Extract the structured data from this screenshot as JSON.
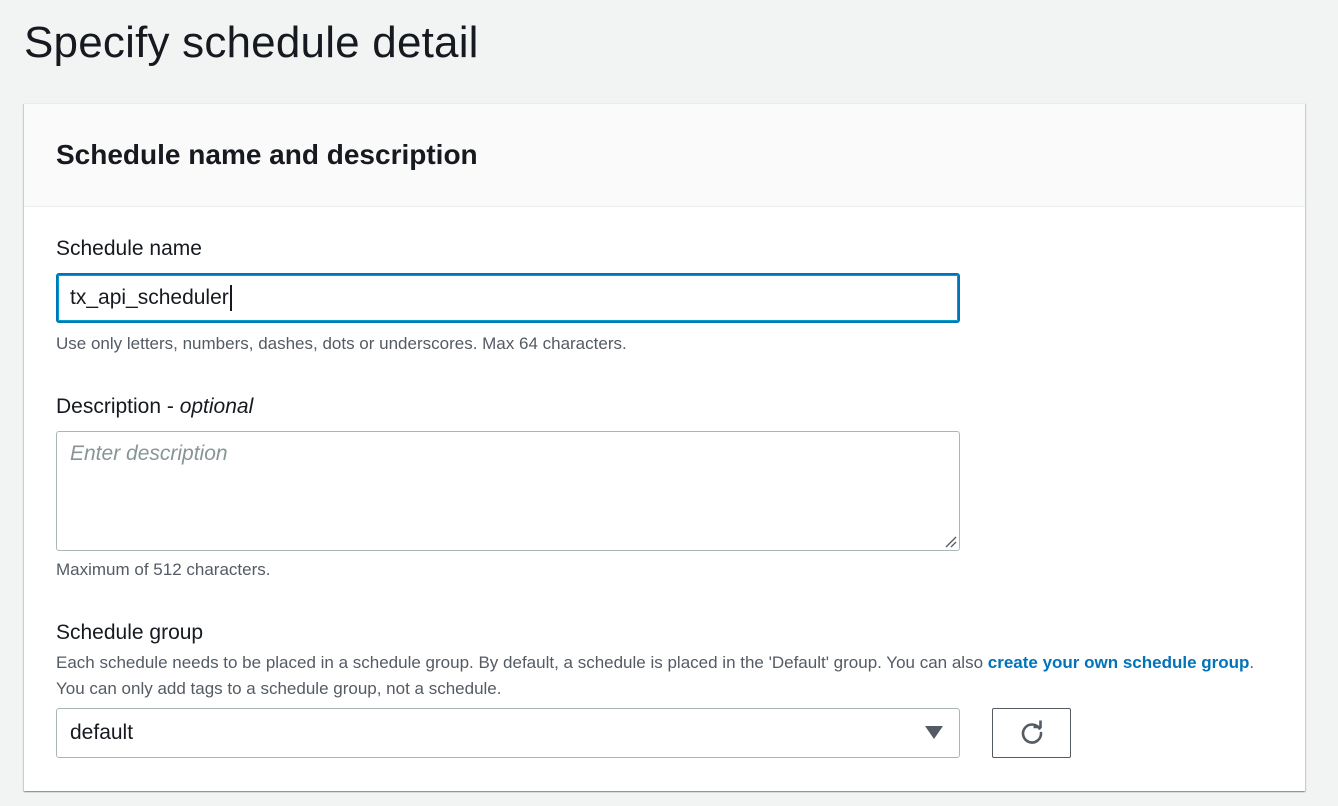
{
  "page": {
    "title": "Specify schedule detail"
  },
  "section": {
    "title": "Schedule name and description"
  },
  "schedule_name": {
    "label": "Schedule name",
    "value": "tx_api_scheduler",
    "hint": "Use only letters, numbers, dashes, dots or underscores. Max 64 characters."
  },
  "description": {
    "label": "Description - ",
    "label_optional": "optional",
    "placeholder": "Enter description",
    "hint": "Maximum of 512 characters."
  },
  "schedule_group": {
    "label": "Schedule group",
    "desc_prefix": "Each schedule needs to be placed in a schedule group. By default, a schedule is placed in the 'Default' group. You can also ",
    "desc_link": "create your own schedule group",
    "desc_suffix": ". You can only add tags to a schedule group, not a schedule.",
    "selected": "default",
    "dropdown_icon": "caret-down-icon",
    "refresh_icon": "refresh-icon"
  },
  "colors": {
    "link": "#0073bb",
    "focus_border": "#0073bb",
    "hint_text": "#545b64",
    "background": "#f2f3f3"
  }
}
